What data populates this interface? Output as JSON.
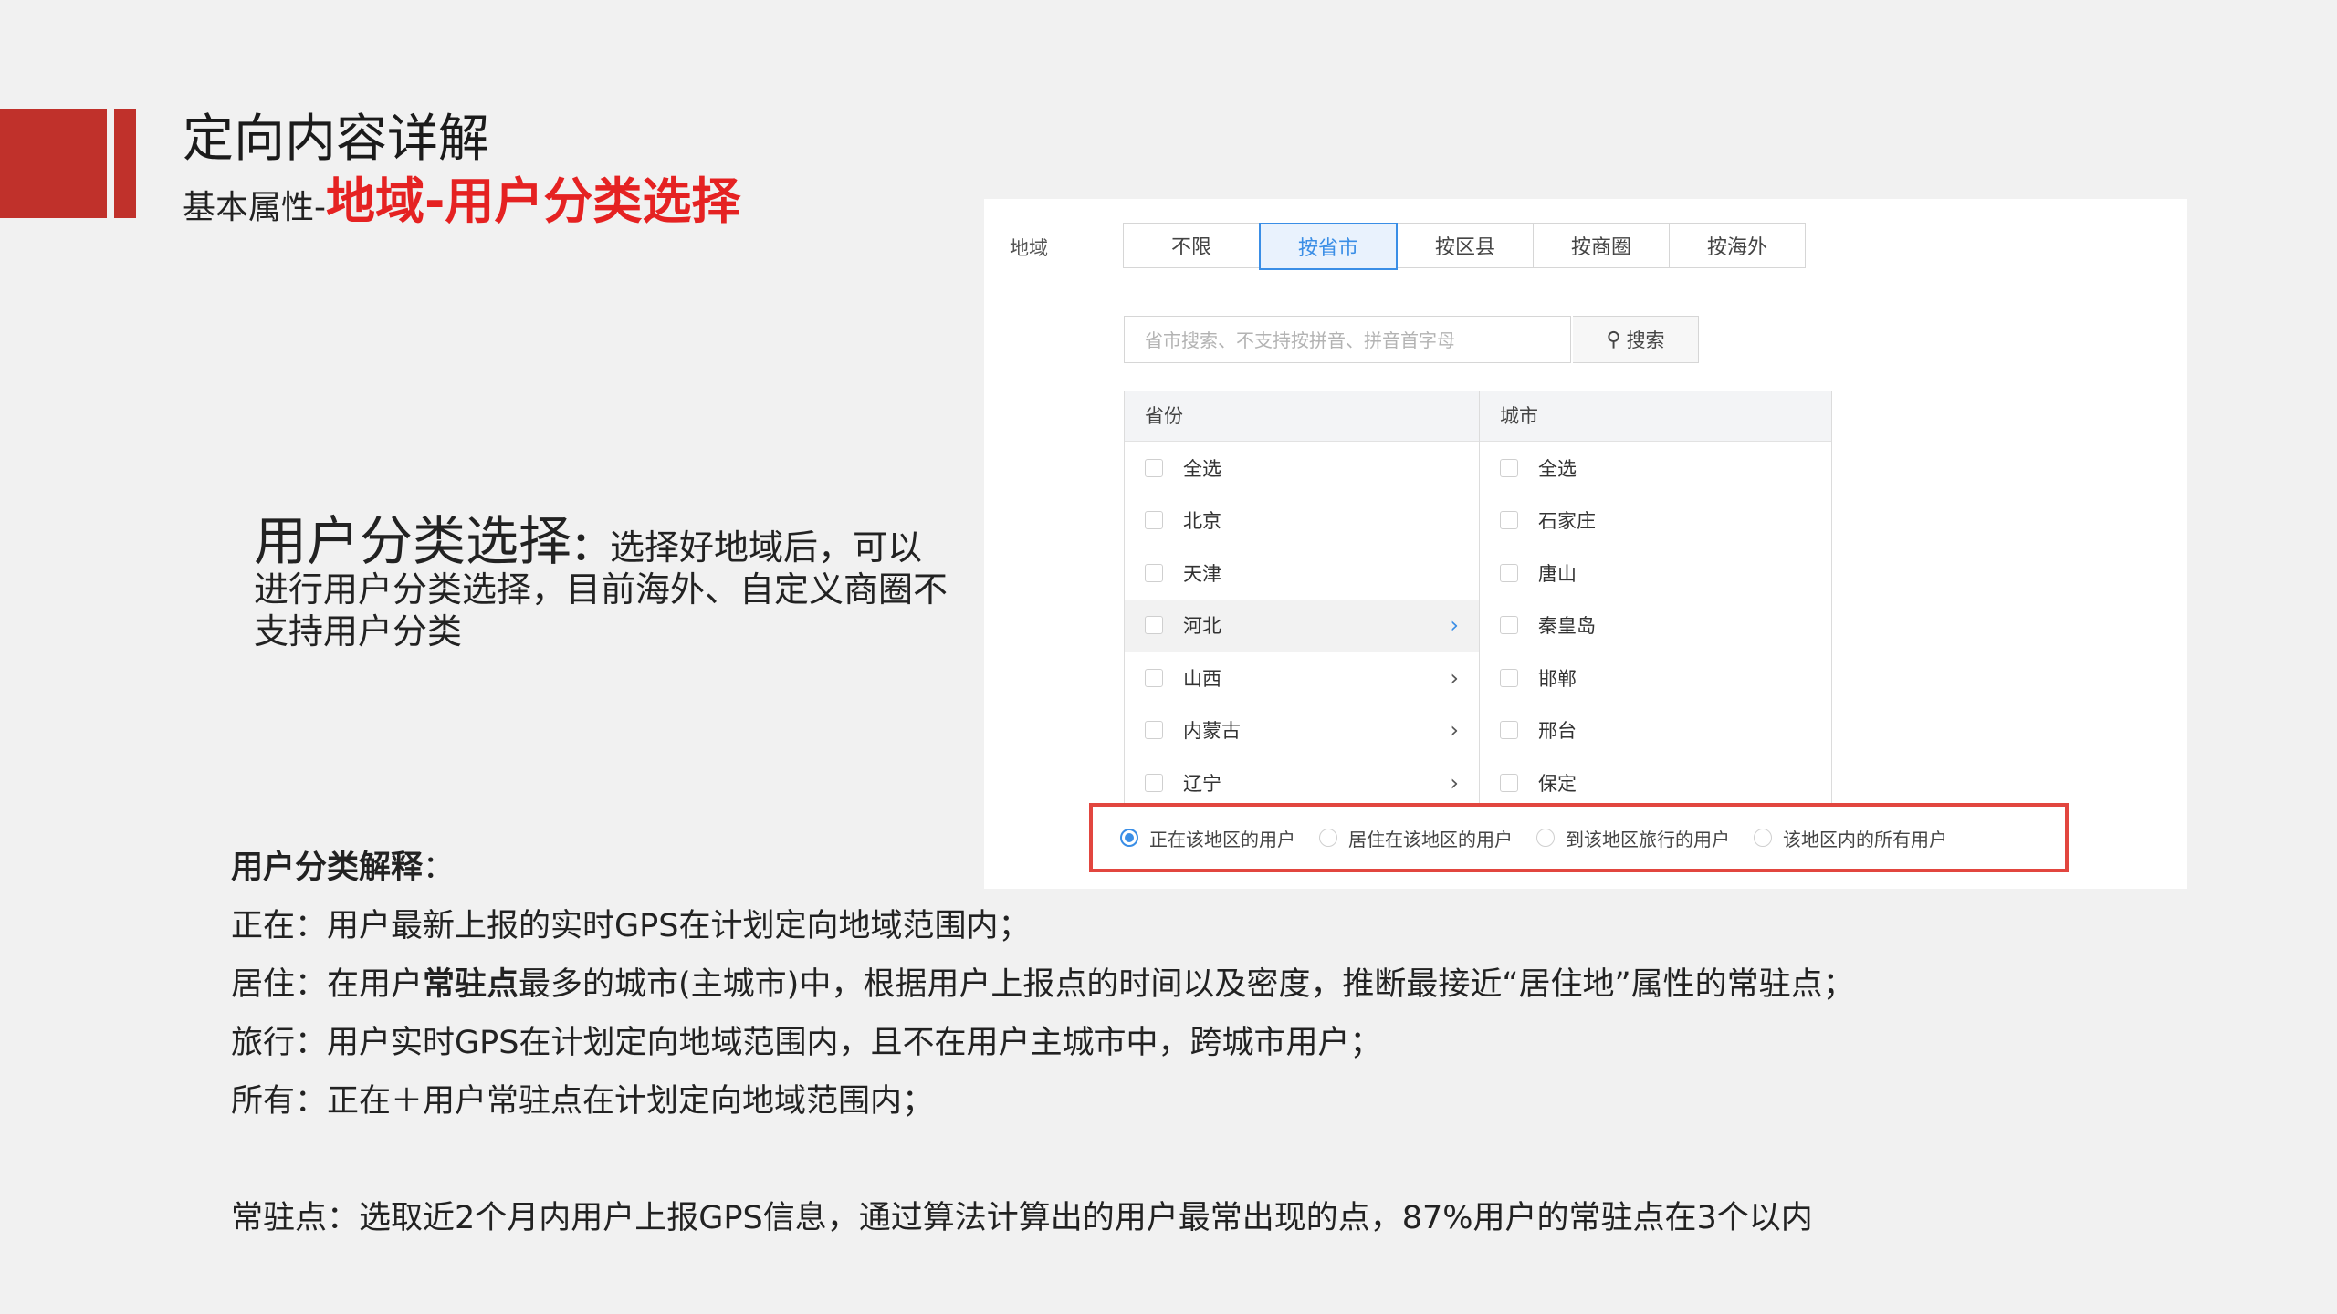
{
  "header": {
    "title": "定向内容详解",
    "subtitle_prefix": "基本属性-",
    "subtitle_highlight": "地域-用户分类选择"
  },
  "description": {
    "heading": "用户分类选择",
    "colon": "：",
    "text": "选择好地域后，可以进行用户分类选择，目前海外、自定义商圈不支持用户分类"
  },
  "screenshot": {
    "region_label": "地域",
    "tabs": [
      "不限",
      "按省市",
      "按区县",
      "按商圈",
      "按海外"
    ],
    "active_tab": "按省市",
    "search_placeholder": "省市搜索、不支持按拼音、拼音首字母",
    "search_button": "搜索",
    "province_header": "省份",
    "city_header": "城市",
    "provinces": [
      "全选",
      "北京",
      "天津",
      "河北",
      "山西",
      "内蒙古",
      "辽宁"
    ],
    "cities": [
      "全选",
      "石家庄",
      "唐山",
      "秦皇岛",
      "邯郸",
      "邢台",
      "保定"
    ],
    "user_types": [
      "正在该地区的用户",
      "居住在该地区的用户",
      "到该地区旅行的用户",
      "该地区内的所有用户"
    ],
    "selected_user_type": "正在该地区的用户"
  },
  "explanation": {
    "title": "用户分类解释",
    "title_colon": "：",
    "zhengzai": "正在：用户最新上报的实时GPS在计划定向地域范围内；",
    "juzhu_a": "居住：在用户",
    "juzhu_bold": "常驻点",
    "juzhu_b": "最多的城市(主城市)中，根据用户上报点的时间以及密度，推断最接近“居住地”属性的常驻点；",
    "lvxing": "旅行：用户实时GPS在计划定向地域范围内，且不在用户主城市中，跨城市用户；",
    "suoyou": "所有：正在＋用户常驻点在计划定向地域范围内；",
    "changzhu": "常驻点：选取近2个月内用户上报GPS信息，通过算法计算出的用户最常出现的点，87%用户的常驻点在3个以内"
  },
  "colors": {
    "accent": "#c0312b",
    "highlight": "#e52222",
    "link_blue": "#3a8ee6",
    "box_red": "#e2463f"
  }
}
